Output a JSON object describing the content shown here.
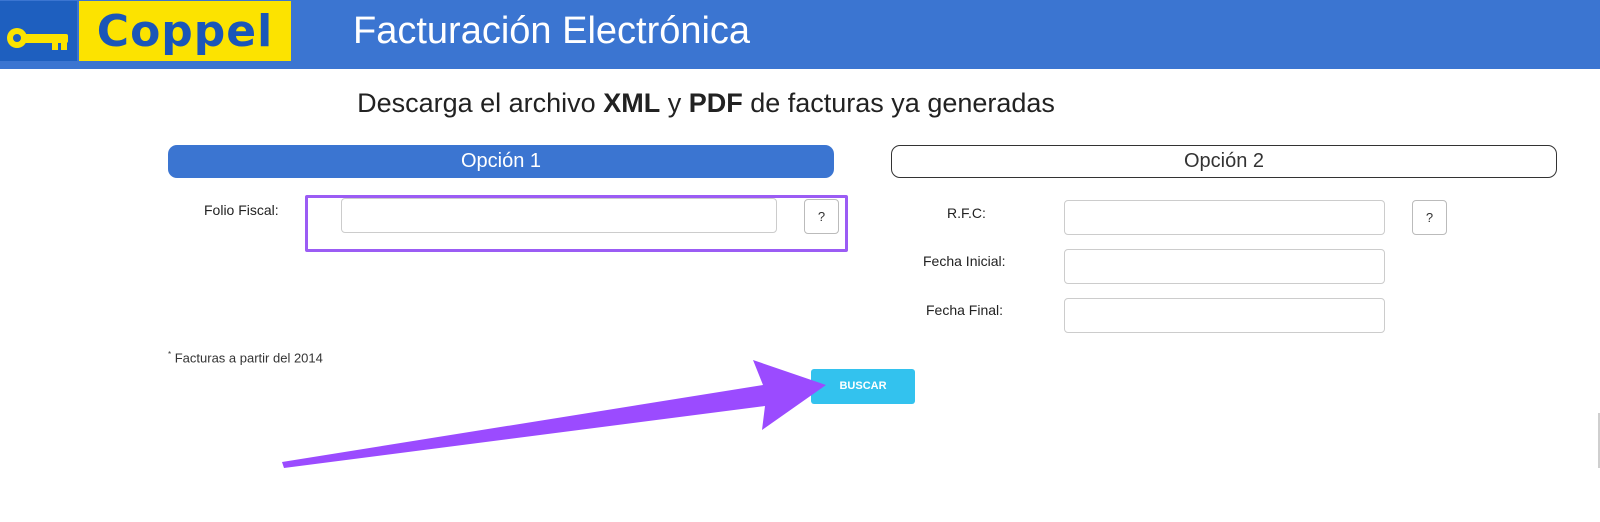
{
  "header": {
    "logo_text": "Coppel",
    "title": "Facturación Electrónica",
    "key_icon": "key-icon"
  },
  "subtitle": {
    "part1": "Descarga el archivo ",
    "xml": "XML",
    "part2": " y ",
    "pdf": "PDF",
    "part3": " de facturas ya generadas"
  },
  "option1": {
    "title": "Opción 1",
    "folio_label": "Folio Fiscal:",
    "folio_value": "",
    "help": "?"
  },
  "option2": {
    "title": "Opción 2",
    "rfc_label": "R.F.C:",
    "rfc_value": "",
    "rfc_help": "?",
    "fecha_inicial_label": "Fecha Inicial:",
    "fecha_inicial_value": "",
    "fecha_final_label": "Fecha Final:",
    "fecha_final_value": ""
  },
  "note": {
    "star": "*",
    "text": " Facturas a partir del 2014"
  },
  "search_button": "BUSCAR",
  "colors": {
    "header_blue": "#3b75d1",
    "logo_yellow": "#fce300",
    "button_cyan": "#33c2ee",
    "annotation_purple": "#9b5cf4"
  }
}
